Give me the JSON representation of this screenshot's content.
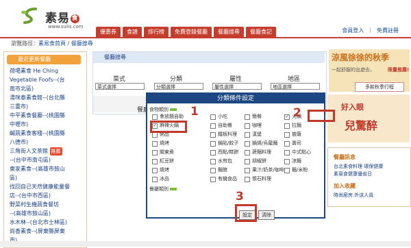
{
  "header": {
    "logo_text": "素易",
    "logo_badge": "食",
    "logo_url": "www.suiis.com",
    "nav": [
      "優惠券",
      "食譜",
      "排行榜",
      "免費登錄餐廳",
      "餐廳搜尋",
      "餐廳食記"
    ],
    "links": {
      "login": "會員登入",
      "register": "免費註冊",
      "sep": "|"
    }
  },
  "breadcrumb": {
    "prefix": "瀏覽路徑：",
    "home": "素易食首頁",
    "sep": " / ",
    "current": "餐廳搜尋"
  },
  "left": {
    "title": "最近更新餐廳",
    "items": [
      "荷噶素食 He Ching",
      "Vegetable Foofs--(台",
      "南市北區)",
      "湯咪泰素食館--(台北縣",
      "三重市)",
      "中平素食餐廳--(桃園縣",
      "中壢市)",
      "鹹蔬素食客棧--(桃園縣",
      "八德市)",
      "三角街人文茶館",
      "--(台中市南屯區)",
      "東家素食--(高雄市鼓山",
      "區)",
      "找回自己天然健康能量餐",
      "店--(台中市西區)",
      "野菜村生機蔬食餐坊",
      "--(高雄市鼓山區)",
      "水木林--(台北市士林區)",
      "尚香素食--(屏東縣屏東",
      "市)"
    ],
    "hot_badge": "推薦"
  },
  "search": {
    "title": "餐廳搜尋",
    "labels": [
      "菜式",
      "分類",
      "屬性",
      "地區"
    ],
    "selects": [
      "菜式選擇",
      "分類選擇",
      "屬性選擇",
      "地區選擇"
    ],
    "name_label": "餐廳名"
  },
  "dialog": {
    "title": "分類條件設定",
    "cat1": "食物類別",
    "cat2": "餐廳類別",
    "options": [
      "會放題自助",
      "小吃",
      "簡餐",
      "火鍋",
      "麻辣火鍋",
      "自助餐",
      "咖哩",
      "拉麵",
      "粥品",
      "鐵板料理",
      "漢堡",
      "披薩",
      "燒烤",
      "鍋貼/餃子",
      "鍋燒/烏龍麵",
      "壽司",
      "關東煮",
      "西點/糕餅",
      "蔬麵料理",
      "中式點心",
      "紅豆餅",
      "水煎包",
      "胡椒餅",
      "涼麵",
      "燒烤",
      "麵館",
      "果汁/奶茶/咖啡",
      "麵/米粉",
      "冰品",
      "有機食品",
      "懷石料理"
    ],
    "checked": [
      "火鍋",
      "麻辣火鍋"
    ],
    "buttons": {
      "set": "設定",
      "clear": "清除"
    },
    "markers": [
      "1",
      "2",
      "3"
    ]
  },
  "right": {
    "ad1_title": "涼風徐徐的秋季",
    "ad1_sub": "一起舒服的出遊去，",
    "ad1_red": "限量推薦!",
    "ad1_btn": "多款秋季行程",
    "ad2_t1": "好入眼",
    "ad2_t2": "兒驚醉",
    "box_head1": "餐廳訊息",
    "box_links": [
      "台北素食料理 環保健康",
      "素易食健康優省日"
    ],
    "box_head2": "加入收藏",
    "box_links2": [
      "時尚廚房.外送人員"
    ]
  }
}
